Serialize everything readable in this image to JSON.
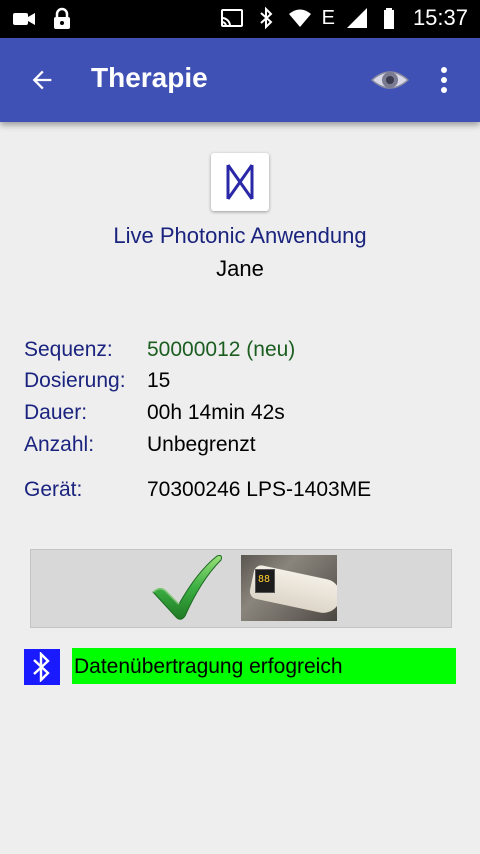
{
  "statusbar": {
    "time": "15:37",
    "network_label": "E",
    "icons": [
      "video-camera-icon",
      "lock-icon",
      "cast-icon",
      "bluetooth-icon",
      "wifi-icon",
      "signal-icon",
      "battery-icon"
    ]
  },
  "appbar": {
    "title": "Therapie",
    "color": "#3f51b5",
    "icons": [
      "back-arrow-icon",
      "eye-icon",
      "more-vert-icon"
    ]
  },
  "app": {
    "name": "Live Photonic Anwendung",
    "user": "Jane"
  },
  "info": {
    "sequence_label": "Sequenz:",
    "sequence_value": "50000012 (neu)",
    "dosage_label": "Dosierung:",
    "dosage_value": "15",
    "duration_label": "Dauer:",
    "duration_value": "00h 14min 42s",
    "count_label": "Anzahl:",
    "count_value": "Unbegrenzt",
    "device_label": "Gerät:",
    "device_value": "70300246 LPS-1403ME"
  },
  "device_panel": {
    "icons": [
      "checkmark-icon",
      "device-photo"
    ]
  },
  "transfer": {
    "status_text": "Datenübertragung erfogreich",
    "status_color": "#00ff00",
    "bluetooth_color": "#1a1aff"
  }
}
